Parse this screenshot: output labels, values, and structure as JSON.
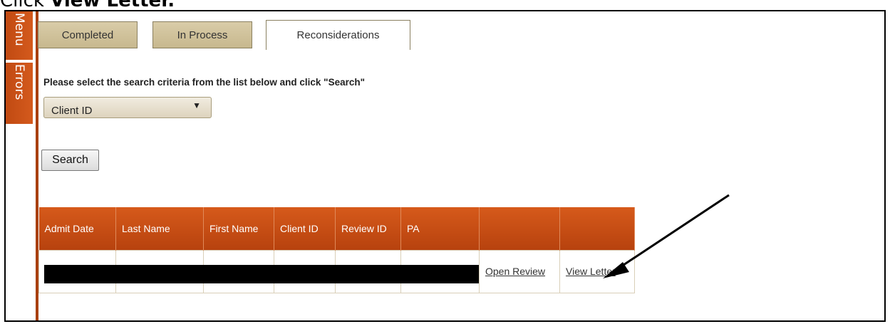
{
  "caption": {
    "prefix": "Click ",
    "bold": "View Letter."
  },
  "side_rail": {
    "menu_label": "Menu",
    "errors_label": "Errors"
  },
  "tabs": [
    {
      "label": "Completed"
    },
    {
      "label": "In Process"
    },
    {
      "label": "Reconsiderations"
    }
  ],
  "instruction": "Please select the search criteria from the list below and click \"Search\"",
  "criteria_select": {
    "selected": "Client ID"
  },
  "search_button": "Search",
  "table": {
    "headers": [
      "Admit Date",
      "Last Name",
      "First Name",
      "Client ID",
      "Review ID",
      "PA",
      "",
      ""
    ],
    "row": {
      "open_review": "Open Review",
      "view_letter": "View Letter"
    }
  }
}
